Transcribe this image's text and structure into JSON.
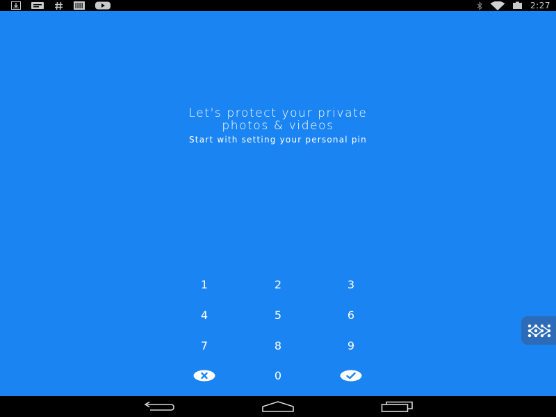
{
  "status_bar": {
    "left_icons": [
      "download-icon",
      "notification-card-icon",
      "hash-icon",
      "barcode-icon",
      "youtube-icon"
    ],
    "right_icons": [
      "bluetooth-icon",
      "wifi-icon",
      "battery-icon"
    ],
    "time": "2:27"
  },
  "onboarding": {
    "title_line1": "Let's protect your private",
    "title_line2": "photos & videos",
    "subtitle": "Start with setting your personal pin"
  },
  "keypad": {
    "keys": [
      "1",
      "2",
      "3",
      "4",
      "5",
      "6",
      "7",
      "8",
      "9",
      "0"
    ],
    "clear_icon": "clear-icon",
    "confirm_icon": "checkmark-icon"
  },
  "side_handle": {
    "icon": "pattern-grid-icon"
  },
  "nav_bar": {
    "icons": [
      "back-icon",
      "home-icon",
      "recent-apps-icon"
    ]
  },
  "colors": {
    "background": "#1b84f3",
    "status_bar": "#000000",
    "side_handle": "#2c6bb8",
    "text": "#ffffff"
  }
}
